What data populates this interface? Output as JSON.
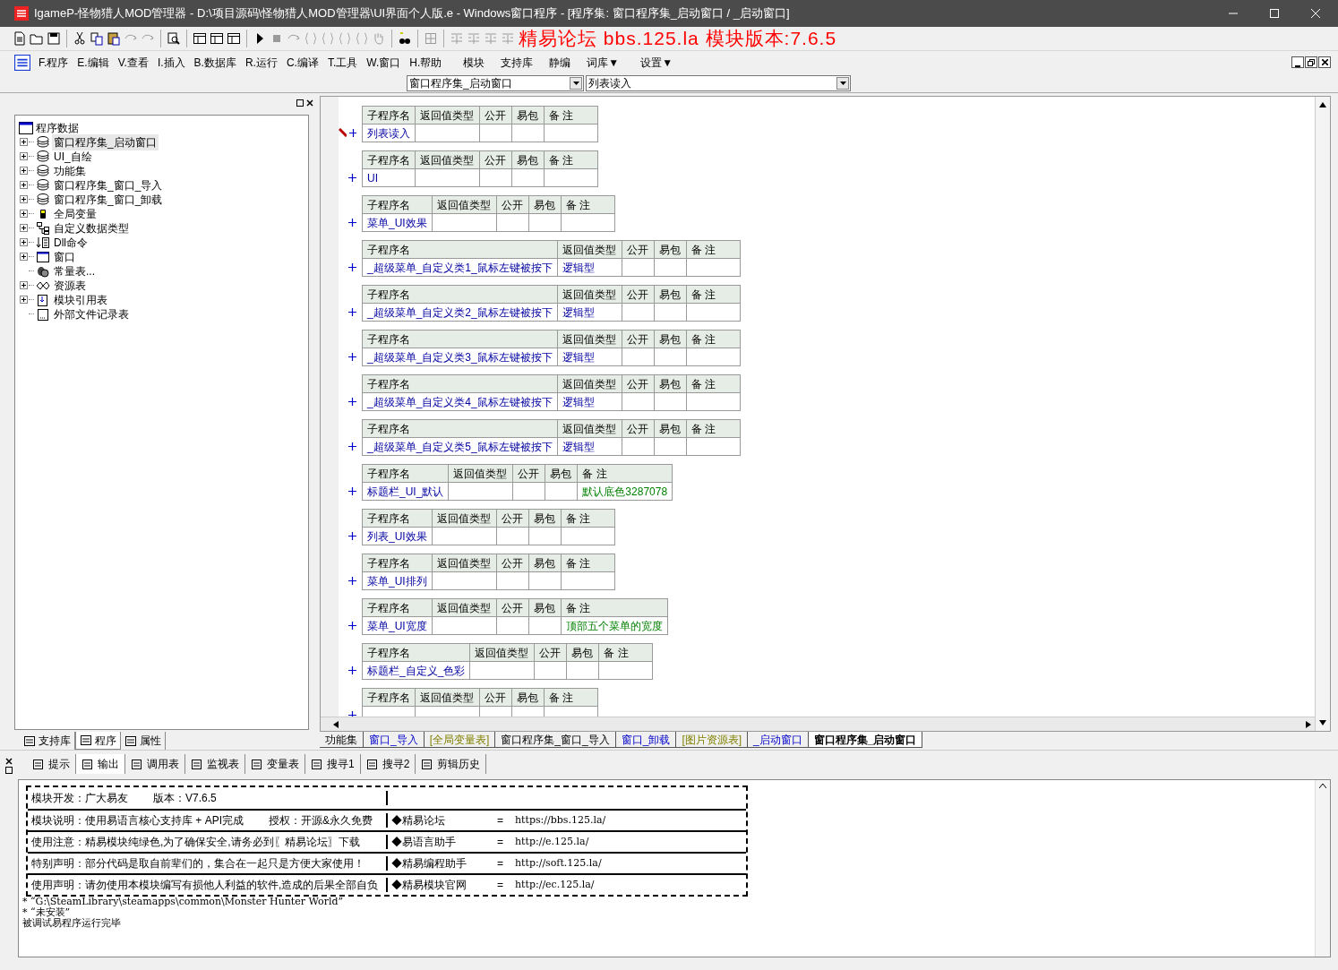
{
  "window": {
    "title": "IgameP-怪物猎人MOD管理器 - D:\\项目源码\\怪物猎人MOD管理器\\UI界面个人版.e - Windows窗口程序 - [程序集: 窗口程序集_启动窗口 / _启动窗口]"
  },
  "toolbar": {
    "banner": "精易论坛 bbs.125.la  模块版本:7.6.5"
  },
  "menu": [
    "F.程序",
    "E.编辑",
    "V.查看",
    "I.插入",
    "B.数据库",
    "R.运行",
    "C.编译",
    "T.工具",
    "W.窗口",
    "H.帮助",
    "模块",
    "支持库",
    "静编",
    "词库▼",
    "设置▼"
  ],
  "selectors": [
    {
      "value": "窗口程序集_启动窗口"
    },
    {
      "value": "列表读入"
    }
  ],
  "tree": {
    "label": "程序数据",
    "children": [
      {
        "label": "窗口程序集_启动窗口",
        "kind": "set",
        "expanded": false,
        "selected": true
      },
      {
        "label": "UI_自绘",
        "kind": "set",
        "expanded": false,
        "selected": false
      },
      {
        "label": "功能集",
        "kind": "set",
        "expanded": false,
        "selected": false
      },
      {
        "label": "窗口程序集_窗口_导入",
        "kind": "set",
        "expanded": false,
        "selected": false
      },
      {
        "label": "窗口程序集_窗口_卸载",
        "kind": "set",
        "expanded": false,
        "selected": false
      },
      {
        "label": "全局变量",
        "kind": "globals",
        "expanded": false,
        "selected": false
      },
      {
        "label": "自定义数据类型",
        "kind": "types",
        "expanded": false,
        "selected": false
      },
      {
        "label": "Dll命令",
        "kind": "dll",
        "expanded": false,
        "selected": false
      },
      {
        "label": "窗口",
        "kind": "window",
        "expanded": false,
        "selected": false
      },
      {
        "label": "常量表...",
        "kind": "constants",
        "selected": false
      },
      {
        "label": "资源表",
        "kind": "resources",
        "expanded": false,
        "selected": false
      },
      {
        "label": "模块引用表",
        "kind": "modules",
        "expanded": false,
        "selected": false
      },
      {
        "label": "外部文件记录表",
        "kind": "files",
        "selected": false
      }
    ]
  },
  "left_tabs": [
    {
      "label": "支持库",
      "selected": false
    },
    {
      "label": "程序",
      "selected": true
    },
    {
      "label": "属性",
      "selected": false
    }
  ],
  "subroutines": [
    {
      "columns": [
        "子程序名",
        "返回值类型",
        "公开",
        "易包",
        "备 注"
      ],
      "name": "列表读入",
      "current": true
    },
    {
      "columns": [
        "子程序名",
        "返回值类型",
        "公开",
        "易包",
        "备 注"
      ],
      "name": "UI",
      "current": false
    },
    {
      "columns": [
        "子程序名",
        "返回值类型",
        "公开",
        "易包",
        "备 注"
      ],
      "name": "菜单_UI效果",
      "current": false
    },
    {
      "columns": [
        "子程序名",
        "返回值类型",
        "公开",
        "易包",
        "备 注"
      ],
      "name": "_超级菜单_自定义类1_鼠标左键被按下",
      "return_type": "逻辑型",
      "current": false
    },
    {
      "columns": [
        "子程序名",
        "返回值类型",
        "公开",
        "易包",
        "备 注"
      ],
      "name": "_超级菜单_自定义类2_鼠标左键被按下",
      "return_type": "逻辑型",
      "current": false
    },
    {
      "columns": [
        "子程序名",
        "返回值类型",
        "公开",
        "易包",
        "备 注"
      ],
      "name": "_超级菜单_自定义类3_鼠标左键被按下",
      "return_type": "逻辑型",
      "current": false
    },
    {
      "columns": [
        "子程序名",
        "返回值类型",
        "公开",
        "易包",
        "备 注"
      ],
      "name": "_超级菜单_自定义类4_鼠标左键被按下",
      "return_type": "逻辑型",
      "current": false
    },
    {
      "columns": [
        "子程序名",
        "返回值类型",
        "公开",
        "易包",
        "备 注"
      ],
      "name": "_超级菜单_自定义类5_鼠标左键被按下",
      "return_type": "逻辑型",
      "current": false
    },
    {
      "columns": [
        "子程序名",
        "返回值类型",
        "公开",
        "易包",
        "备 注"
      ],
      "name": "标题栏_UI_默认",
      "remark": "默认底色3287078",
      "current": false
    },
    {
      "columns": [
        "子程序名",
        "返回值类型",
        "公开",
        "易包",
        "备 注"
      ],
      "name": "列表_UI效果",
      "current": false
    },
    {
      "columns": [
        "子程序名",
        "返回值类型",
        "公开",
        "易包",
        "备 注"
      ],
      "name": "菜单_UI排列",
      "current": false
    },
    {
      "columns": [
        "子程序名",
        "返回值类型",
        "公开",
        "易包",
        "备 注"
      ],
      "name": "菜单_UI宽度",
      "remark": "顶部五个菜单的宽度",
      "current": false
    },
    {
      "columns": [
        "子程序名",
        "返回值类型",
        "公开",
        "易包",
        "备 注"
      ],
      "name": "标题栏_自定义_色彩",
      "current": false
    },
    {
      "columns": [
        "子程序名",
        "返回值类型",
        "公开",
        "易包",
        "备 注"
      ],
      "current": false
    }
  ],
  "code_tabs": [
    {
      "label": "功能集",
      "kind": "assembly",
      "selected": false
    },
    {
      "label": "窗口_导入",
      "kind": "window",
      "selected": false
    },
    {
      "label": "[全局变量表]",
      "kind": "table",
      "selected": false
    },
    {
      "label": "窗口程序集_窗口_导入",
      "kind": "assembly",
      "selected": false
    },
    {
      "label": "窗口_卸载",
      "kind": "window",
      "selected": false
    },
    {
      "label": "[图片资源表]",
      "kind": "table",
      "selected": false
    },
    {
      "label": "_启动窗口",
      "kind": "window",
      "selected": false
    },
    {
      "label": "窗口程序集_启动窗口",
      "kind": "assembly",
      "selected": true
    }
  ],
  "bottom_tabs": [
    {
      "label": "提示",
      "selected": false
    },
    {
      "label": "输出",
      "selected": true
    },
    {
      "label": "调用表",
      "selected": false
    },
    {
      "label": "监视表",
      "selected": false
    },
    {
      "label": "变量表",
      "selected": false
    },
    {
      "label": "搜寻1",
      "selected": false
    },
    {
      "label": "搜寻2",
      "selected": false
    },
    {
      "label": "剪辑历史",
      "selected": false
    }
  ],
  "output": {
    "info_rows": [
      {
        "left": [
          "模块开发：广大易友",
          "版本：V7.6.5"
        ]
      },
      {
        "left": [
          "模块说明：使用易语言核心支持库 + API完成",
          "授权：开源&永久免费"
        ],
        "site": "◆精易论坛",
        "eq": "=",
        "url": "https://bbs.125.la/"
      },
      {
        "left": [
          "使用注意：精易模块纯绿色,为了确保安全,请务必到〖精易论坛〗下载"
        ],
        "site": "◆易语言助手",
        "eq": "=",
        "url": "http://e.125.la/"
      },
      {
        "left": [
          "特别声明：部分代码是取自前辈们的，集合在一起只是方便大家使用！"
        ],
        "site": "◆精易编程助手",
        "eq": "=",
        "url": "http://soft.125.la/"
      },
      {
        "left": [
          "使用声明：请勿使用本模块编写有损他人利益的软件,造成的后果全部自负"
        ],
        "site": "◆精易模块官网",
        "eq": "=",
        "url": "http://ec.125.la/"
      }
    ],
    "lines": [
      "* “G:\\SteamLibrary\\steamapps\\common\\Monster Hunter World”",
      "* “未安装”",
      "被调试易程序运行完毕"
    ]
  }
}
